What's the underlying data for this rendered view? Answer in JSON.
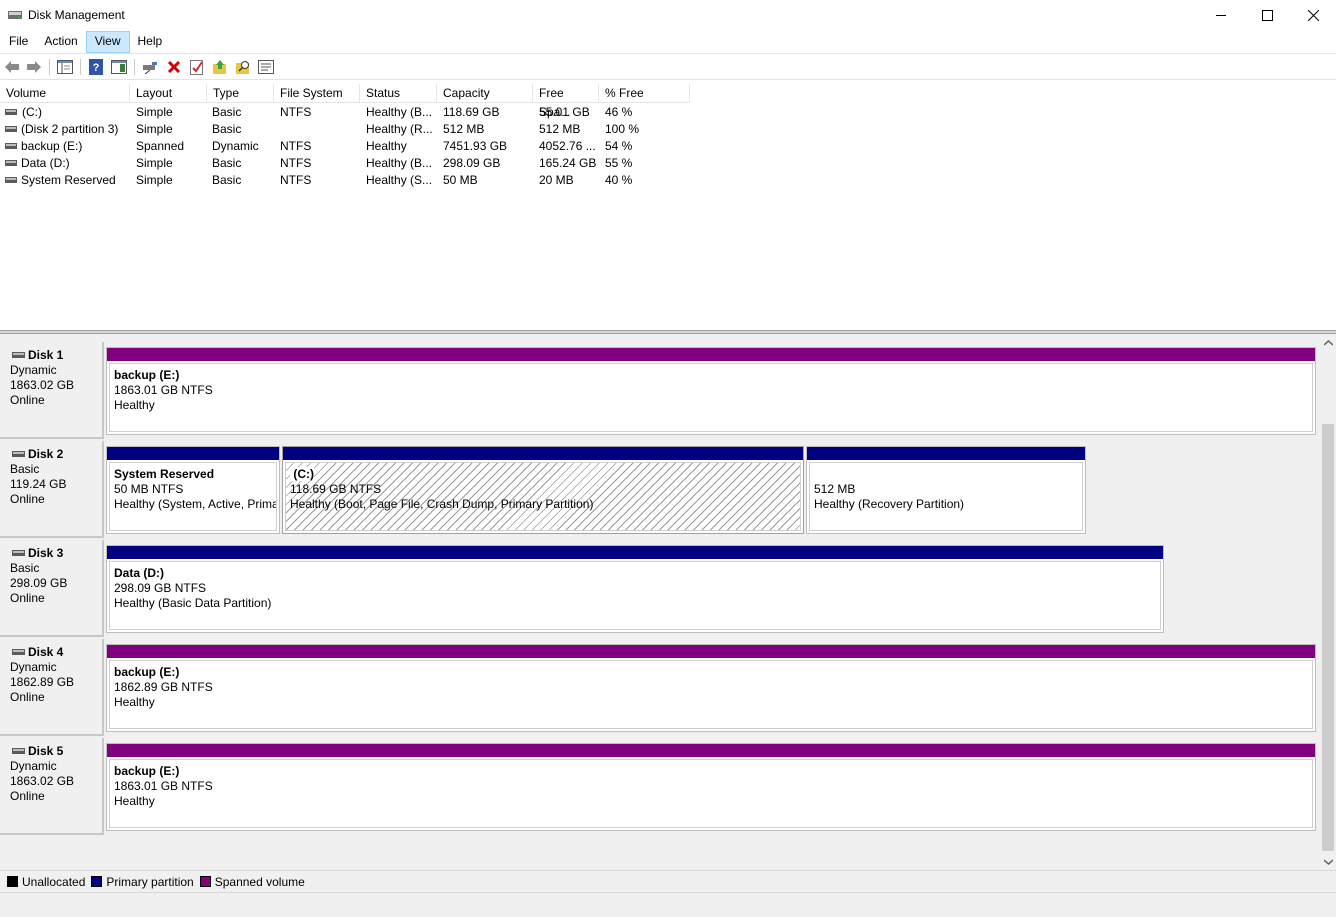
{
  "window": {
    "title": "Disk Management",
    "controls": {
      "minimize": "minimize",
      "maximize": "maximize",
      "close": "close"
    }
  },
  "menu": [
    "File",
    "Action",
    "View",
    "Help"
  ],
  "menu_active": "View",
  "toolbar": {
    "icons": [
      "back-arrow-icon",
      "forward-arrow-icon",
      "console-tree-icon",
      "help-icon",
      "show-pane-icon",
      "connect-drive-icon",
      "delete-icon",
      "properties-icon",
      "up-folder-icon",
      "search-folder-icon",
      "rescan-icon"
    ]
  },
  "volume_list": {
    "columns": [
      "Volume",
      "Layout",
      "Type",
      "File System",
      "Status",
      "Capacity",
      "Free Spa...",
      "% Free"
    ],
    "rows": [
      {
        "volume": "(C:)",
        "layout": "Simple",
        "type": "Basic",
        "fs": "NTFS",
        "status": "Healthy (B...",
        "capacity": "118.69 GB",
        "free": "55.01 GB",
        "pct": "46 %"
      },
      {
        "volume": "(Disk 2 partition 3)",
        "layout": "Simple",
        "type": "Basic",
        "fs": "",
        "status": "Healthy (R...",
        "capacity": "512 MB",
        "free": "512 MB",
        "pct": "100 %"
      },
      {
        "volume": "backup (E:)",
        "layout": "Spanned",
        "type": "Dynamic",
        "fs": "NTFS",
        "status": "Healthy",
        "capacity": "7451.93 GB",
        "free": "4052.76 ...",
        "pct": "54 %"
      },
      {
        "volume": "Data (D:)",
        "layout": "Simple",
        "type": "Basic",
        "fs": "NTFS",
        "status": "Healthy (B...",
        "capacity": "298.09 GB",
        "free": "165.24 GB",
        "pct": "55 %"
      },
      {
        "volume": "System Reserved",
        "layout": "Simple",
        "type": "Basic",
        "fs": "NTFS",
        "status": "Healthy (S...",
        "capacity": "50 MB",
        "free": "20 MB",
        "pct": "40 %"
      }
    ]
  },
  "disks": [
    {
      "name": "Disk 1",
      "type": "Dynamic",
      "size": "1863.02 GB",
      "state": "Online",
      "partitions": [
        {
          "name": "backup  (E:)",
          "size": "1863.01 GB NTFS",
          "status": "Healthy",
          "kind": "spanned"
        }
      ]
    },
    {
      "name": "Disk 2",
      "type": "Basic",
      "size": "119.24 GB",
      "state": "Online",
      "partitions": [
        {
          "name": "System Reserved",
          "size": "50 MB NTFS",
          "status": "Healthy (System, Active, Prima",
          "kind": "primary"
        },
        {
          "name": "(C:)",
          "size": "118.69 GB NTFS",
          "status": "Healthy (Boot, Page File, Crash Dump, Primary Partition)",
          "kind": "primary"
        },
        {
          "name": "",
          "size": "512 MB",
          "status": "Healthy (Recovery Partition)",
          "kind": "primary"
        }
      ]
    },
    {
      "name": "Disk 3",
      "type": "Basic",
      "size": "298.09 GB",
      "state": "Online",
      "partitions": [
        {
          "name": "Data  (D:)",
          "size": "298.09 GB NTFS",
          "status": "Healthy (Basic Data Partition)",
          "kind": "primary"
        }
      ]
    },
    {
      "name": "Disk 4",
      "type": "Dynamic",
      "size": "1862.89 GB",
      "state": "Online",
      "partitions": [
        {
          "name": "backup  (E:)",
          "size": "1862.89 GB NTFS",
          "status": "Healthy",
          "kind": "spanned"
        }
      ]
    },
    {
      "name": "Disk 5",
      "type": "Dynamic",
      "size": "1863.02 GB",
      "state": "Online",
      "partitions": [
        {
          "name": "backup  (E:)",
          "size": "1863.01 GB NTFS",
          "status": "Healthy",
          "kind": "spanned"
        }
      ]
    }
  ],
  "legend": [
    {
      "label": "Unallocated",
      "color": "#000000"
    },
    {
      "label": "Primary partition",
      "color": "#000080"
    },
    {
      "label": "Spanned volume",
      "color": "#800080"
    }
  ],
  "colors": {
    "primary": "#000080",
    "spanned": "#800080",
    "selection": "#cce8ff"
  }
}
